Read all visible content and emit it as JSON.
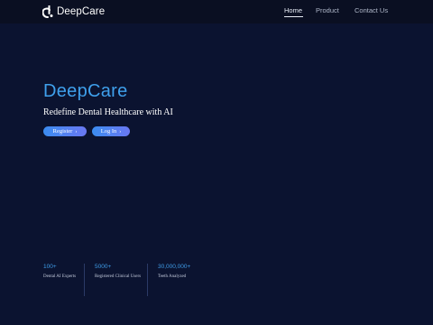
{
  "header": {
    "brand": "DeepCare",
    "nav": [
      "Home",
      "Product",
      "Contact Us"
    ]
  },
  "hero": {
    "title": "DeepCare",
    "subtitle": "Redefine Dental Healthcare with AI",
    "register_label": "Register",
    "login_label": "Log In"
  },
  "stats": [
    {
      "value": "100+",
      "label": "Dental AI Experts"
    },
    {
      "value": "5000+",
      "label": "Registered Clinical Users"
    },
    {
      "value": "30,000,000+",
      "label": "Teeth Analyzed"
    }
  ],
  "colors": {
    "background": "#0b1330",
    "accent": "#3fa0ec",
    "button_gradient_start": "#3b8cf0",
    "button_gradient_end": "#6a78f2"
  },
  "icons": {
    "logo": "deepcare-logo-icon",
    "button_arrow": "chevron-right-icon"
  }
}
